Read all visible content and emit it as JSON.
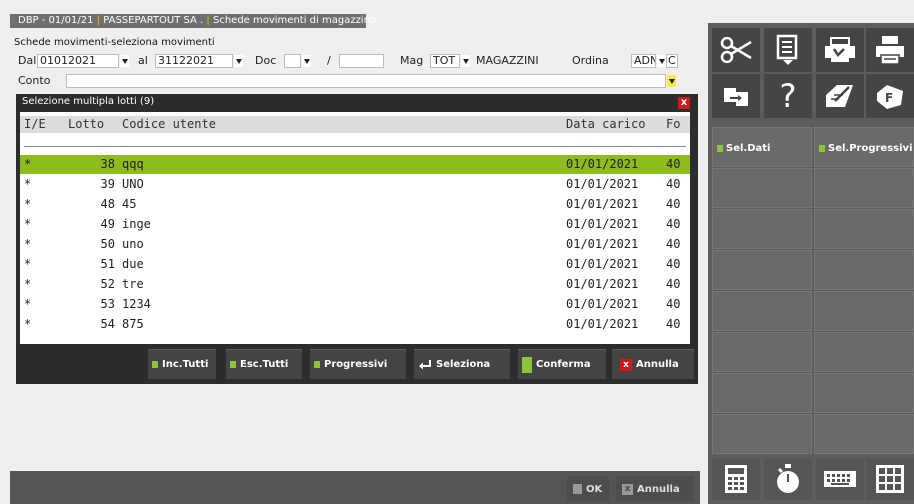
{
  "window_tab": {
    "company": "DBP - 01/01/21",
    "firm": "PASSEPARTOUT SA .",
    "title": "Schede movimenti di magazzino"
  },
  "form": {
    "title": "Schede movimenti-seleziona movimenti",
    "dal_label": "Dal",
    "dal_value": "01012021",
    "al_label": "al",
    "al_value": "31122021",
    "doc_label": "Doc",
    "doc_value": "",
    "slash": "/",
    "doc_number": "",
    "mag_label": "Mag",
    "mag_value": "TOT",
    "mag_desc": "MAGAZZINI",
    "ordina_label": "Ordina",
    "ordina_value": "ADN",
    "ordina_extra": "C",
    "conto_label": "Conto",
    "conto_value": ""
  },
  "modal": {
    "title": "Selezione multipla lotti (9)",
    "close_label": "x",
    "columns": {
      "ie": "I/E",
      "lotto": "Lotto",
      "codice": "Codice utente",
      "data": "Data carico",
      "fo": "Fo"
    },
    "rows": [
      {
        "mark": "*",
        "lotto": "38",
        "codice": "qqq",
        "data": "01/01/2021",
        "fo": "40"
      },
      {
        "mark": "*",
        "lotto": "39",
        "codice": "UNO",
        "data": "01/01/2021",
        "fo": "40"
      },
      {
        "mark": "*",
        "lotto": "48",
        "codice": "45",
        "data": "01/01/2021",
        "fo": "40"
      },
      {
        "mark": "*",
        "lotto": "49",
        "codice": "inge",
        "data": "01/01/2021",
        "fo": "40"
      },
      {
        "mark": "*",
        "lotto": "50",
        "codice": "uno",
        "data": "01/01/2021",
        "fo": "40"
      },
      {
        "mark": "*",
        "lotto": "51",
        "codice": "due",
        "data": "01/01/2021",
        "fo": "40"
      },
      {
        "mark": "*",
        "lotto": "52",
        "codice": "tre",
        "data": "01/01/2021",
        "fo": "40"
      },
      {
        "mark": "*",
        "lotto": "53",
        "codice": "1234",
        "data": "01/01/2021",
        "fo": "40"
      },
      {
        "mark": "*",
        "lotto": "54",
        "codice": "875",
        "data": "01/01/2021",
        "fo": "40"
      }
    ],
    "buttons": {
      "inc_tutti": "Inc.Tutti",
      "esc_tutti": "Esc.Tutti",
      "progressivi": "Progressivi",
      "seleziona": "Seleziona",
      "conferma": "Conferma",
      "annulla": "Annulla"
    }
  },
  "right_panel": {
    "tools": [
      "scissors-icon",
      "document-icon",
      "printer-loading-icon",
      "printer-icon",
      "copy-icon",
      "help-icon",
      "notes-icon",
      "f-key-icon"
    ],
    "help_glyph": "?",
    "sel_dati": "Sel.Dati",
    "sel_progressivi": "Sel.Progressivi",
    "bottom_tools": [
      "calculator-icon",
      "stopwatch-icon",
      "keyboard-icon",
      "grid-icon"
    ]
  },
  "footer": {
    "ok": "OK",
    "annulla": "Annulla"
  },
  "colors": {
    "accent_green": "#8cbc1e",
    "button_green": "#8cc43a",
    "close_red": "#d21919",
    "dark_panel": "#2c2c2c"
  }
}
